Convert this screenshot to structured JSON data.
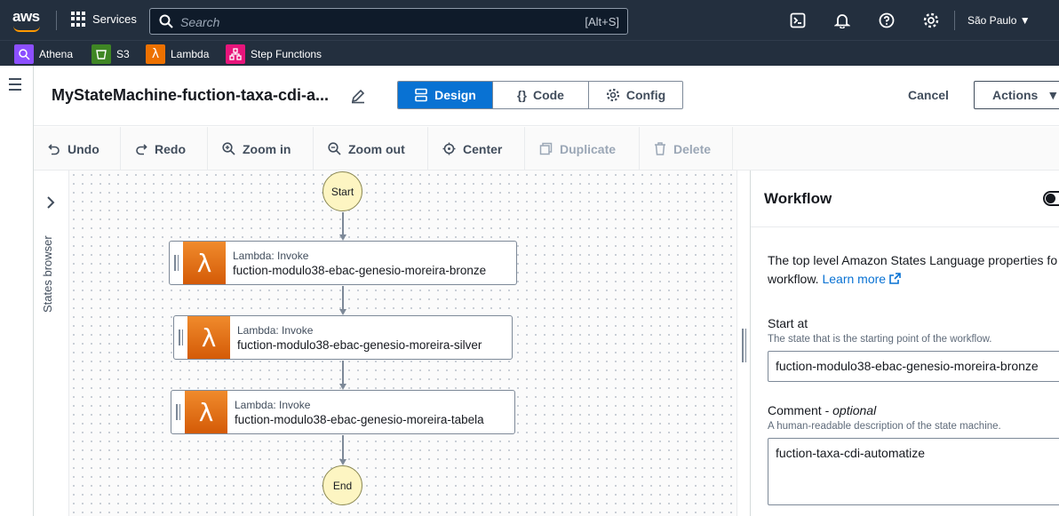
{
  "topbar": {
    "logo": "aws",
    "services_label": "Services",
    "search_placeholder": "Search",
    "search_shortcut": "[Alt+S]",
    "region": "São Paulo",
    "icons": [
      "cloudshell-icon",
      "bell-icon",
      "help-icon",
      "gear-icon"
    ]
  },
  "favorites": [
    {
      "label": "Athena",
      "color": "#8c4fff"
    },
    {
      "label": "S3",
      "color": "#3f8624"
    },
    {
      "label": "Lambda",
      "color": "#ed7100"
    },
    {
      "label": "Step Functions",
      "color": "#e7157b"
    }
  ],
  "header": {
    "title": "MyStateMachine-fuction-taxa-cdi-a...",
    "tabs": [
      "Design",
      "Code",
      "Config"
    ],
    "active_tab": "Design",
    "cancel_label": "Cancel",
    "actions_label": "Actions"
  },
  "toolbar": {
    "undo": "Undo",
    "redo": "Redo",
    "zoom_in": "Zoom in",
    "zoom_out": "Zoom out",
    "center": "Center",
    "duplicate": "Duplicate",
    "delete": "Delete"
  },
  "states_browser": {
    "label": "States browser"
  },
  "graph": {
    "start": "Start",
    "end": "End",
    "states": [
      {
        "type": "Lambda: Invoke",
        "name": "fuction-modulo38-ebac-genesio-moreira-bronze"
      },
      {
        "type": "Lambda: Invoke",
        "name": "fuction-modulo38-ebac-genesio-moreira-silver"
      },
      {
        "type": "Lambda: Invoke",
        "name": "fuction-modulo38-ebac-genesio-moreira-tabela"
      }
    ]
  },
  "panel": {
    "title": "Workflow",
    "description_line1": "The top level Amazon States Language properties fo",
    "description_line2": "workflow.",
    "learn_more": "Learn more",
    "start_at_label": "Start at",
    "start_at_hint": "The state that is the starting point of the workflow.",
    "start_at_value": "fuction-modulo38-ebac-genesio-moreira-bronze",
    "comment_label": "Comment",
    "comment_optional": "optional",
    "comment_hint": "A human-readable description of the state machine.",
    "comment_value": "fuction-taxa-cdi-automatize"
  }
}
